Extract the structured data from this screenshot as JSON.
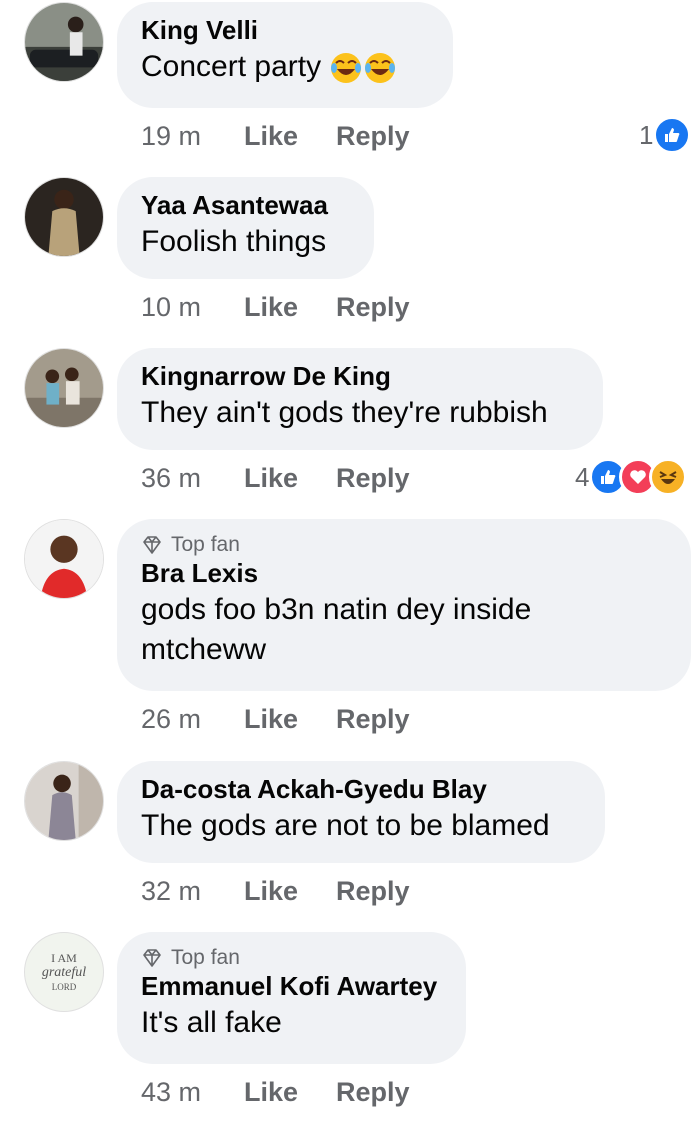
{
  "comments": [
    {
      "name": "King Velli",
      "text": "Concert party",
      "emojis": [
        "tears-of-joy-emoji",
        "tears-of-joy-emoji"
      ],
      "time": "19 m",
      "like": "Like",
      "reply": "Reply",
      "reaction_count": "1",
      "reactions": [
        "like"
      ]
    },
    {
      "name": "Yaa Asantewaa",
      "text": "Foolish things",
      "time": "10 m",
      "like": "Like",
      "reply": "Reply"
    },
    {
      "name": "Kingnarrow De King",
      "text": "They ain't gods they're rubbish",
      "time": "36 m",
      "like": "Like",
      "reply": "Reply",
      "reaction_count": "4",
      "reactions": [
        "like",
        "love",
        "haha"
      ]
    },
    {
      "badge": "Top fan",
      "name": "Bra Lexis",
      "text_lines": [
        "gods foo b3n natin dey inside",
        "mtcheww"
      ],
      "time": "26 m",
      "like": "Like",
      "reply": "Reply"
    },
    {
      "name": "Da-costa Ackah-Gyedu Blay",
      "text": "The gods are not to be blamed",
      "time": "32 m",
      "like": "Like",
      "reply": "Reply"
    },
    {
      "badge": "Top fan",
      "name": "Emmanuel Kofi Awartey",
      "text": "It's all fake",
      "time": "43 m",
      "like": "Like",
      "reply": "Reply",
      "avatar_text": [
        "I AM",
        "grateful",
        "LORD"
      ]
    }
  ],
  "colors": {
    "bubble": "#f0f2f5",
    "meta": "#65676b",
    "like_blue": "#1877f2",
    "love_red": "#f33e58",
    "haha_yellow": "#f7b125"
  }
}
